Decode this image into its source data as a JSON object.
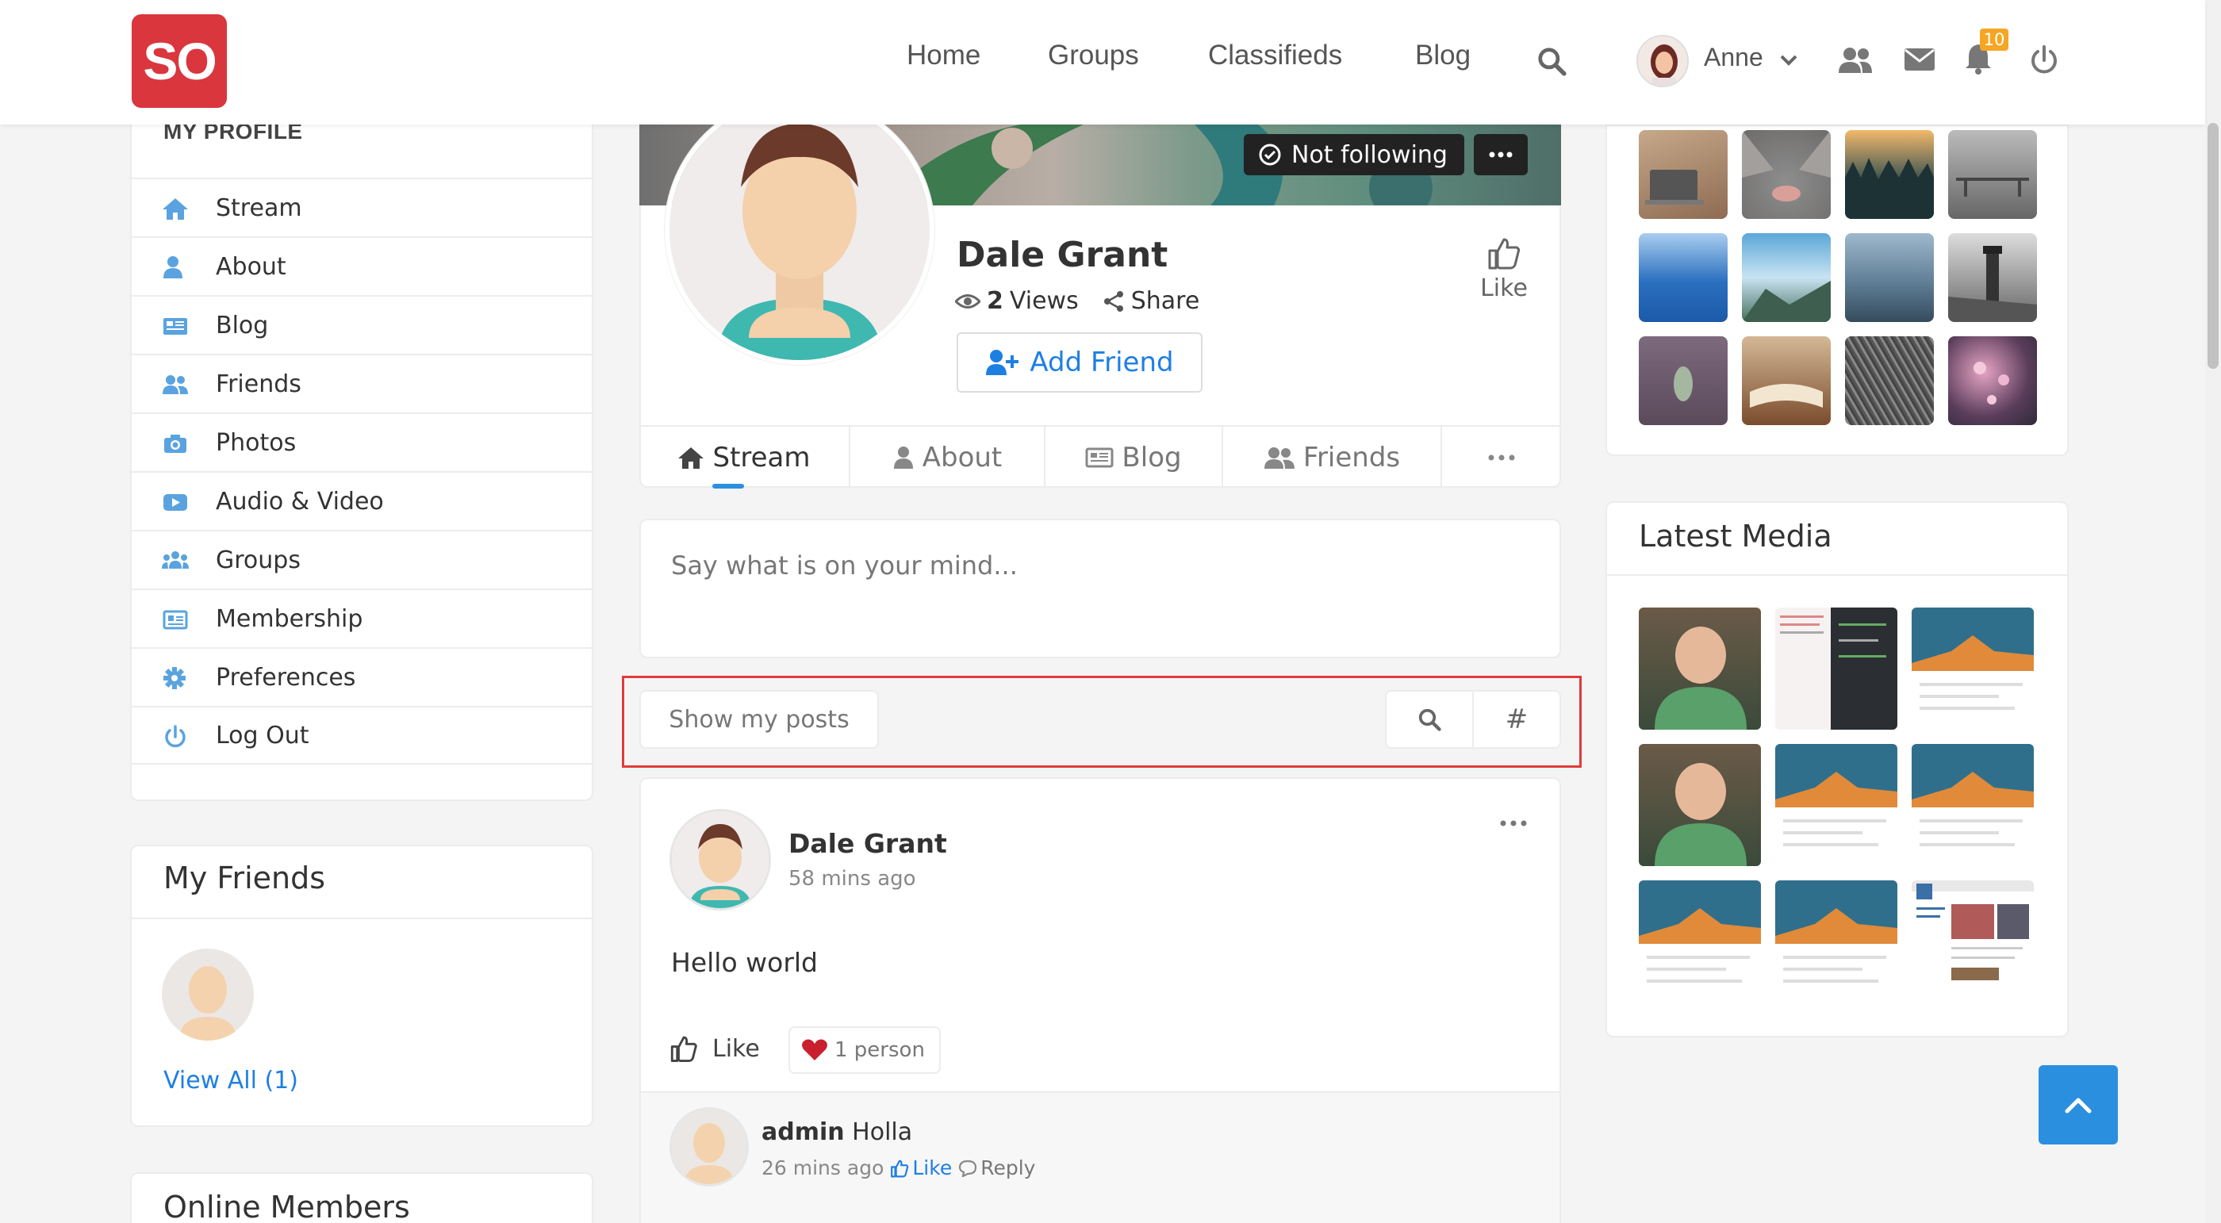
{
  "brand": {
    "logo_text": "SO",
    "logo_color": "#d9363e"
  },
  "nav": {
    "links": [
      "Home",
      "Groups",
      "Classifieds",
      "Blog"
    ],
    "user_name": "Anne",
    "notification_count": "10"
  },
  "left": {
    "profile_title": "MY PROFILE",
    "menu": [
      {
        "label": "Stream",
        "icon": "home-icon"
      },
      {
        "label": "About",
        "icon": "user-icon"
      },
      {
        "label": "Blog",
        "icon": "newspaper-icon"
      },
      {
        "label": "Friends",
        "icon": "users-icon"
      },
      {
        "label": "Photos",
        "icon": "camera-icon"
      },
      {
        "label": "Audio & Video",
        "icon": "play-icon"
      },
      {
        "label": "Groups",
        "icon": "group-icon"
      },
      {
        "label": "Membership",
        "icon": "id-card-icon"
      },
      {
        "label": "Preferences",
        "icon": "gear-icon"
      },
      {
        "label": "Log Out",
        "icon": "power-icon"
      }
    ],
    "friends_title": "My Friends",
    "view_all": "View All (1)",
    "online_title": "Online Members"
  },
  "profile": {
    "follow_status": "Not following",
    "name": "Dale Grant",
    "views_count": "2",
    "views_label": "Views",
    "share_label": "Share",
    "like_label": "Like",
    "add_friend_label": "Add Friend",
    "tabs": [
      "Stream",
      "About",
      "Blog",
      "Friends"
    ]
  },
  "composer": {
    "placeholder": "Say what is on your mind..."
  },
  "filter": {
    "show_posts_label": "Show my posts",
    "hash_label": "#"
  },
  "post": {
    "author": "Dale Grant",
    "time": "58 mins ago",
    "text": "Hello world",
    "like_label": "Like",
    "reactions": "1 person",
    "comment": {
      "author": "admin",
      "text": "Holla",
      "time": "26 mins ago",
      "like_label": "Like",
      "reply_label": "Reply"
    }
  },
  "right": {
    "media_title": "Latest Media"
  },
  "colors": {
    "accent": "#2b8fe0",
    "link": "#1e7fe3",
    "highlight_border": "#e23b3b",
    "badge": "#f5a623"
  }
}
